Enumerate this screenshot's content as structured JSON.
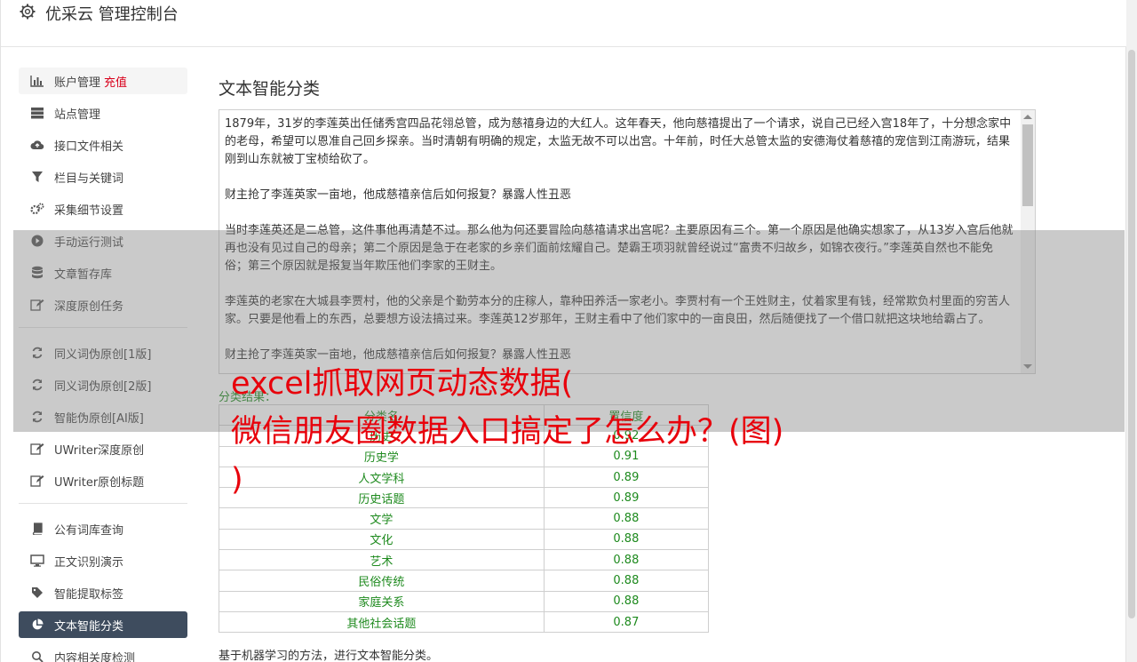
{
  "header": {
    "title": "优采云 管理控制台"
  },
  "sidebar": {
    "group1": [
      {
        "label": "账户管理",
        "extra": "充值",
        "icon": "bar-chart-icon"
      },
      {
        "label": "站点管理",
        "icon": "server-icon"
      },
      {
        "label": "接口文件相关",
        "icon": "cloud-upload-icon"
      },
      {
        "label": "栏目与关键词",
        "icon": "filter-icon"
      },
      {
        "label": "采集细节设置",
        "icon": "gears-icon"
      },
      {
        "label": "手动运行测试",
        "icon": "play-circle-icon"
      },
      {
        "label": "文章暂存库",
        "icon": "database-icon"
      },
      {
        "label": "深度原创任务",
        "icon": "edit-icon"
      }
    ],
    "group2": [
      {
        "label": "同义词伪原创[1版]",
        "icon": "refresh-icon"
      },
      {
        "label": "同义词伪原创[2版]",
        "icon": "refresh-icon"
      },
      {
        "label": "智能伪原创[AI版]",
        "icon": "refresh-icon"
      },
      {
        "label": "UWriter深度原创",
        "icon": "edit-icon"
      },
      {
        "label": "UWriter原创标题",
        "icon": "edit-icon"
      }
    ],
    "group3": [
      {
        "label": "公有词库查询",
        "icon": "book-icon"
      },
      {
        "label": "正文识别演示",
        "icon": "monitor-icon"
      },
      {
        "label": "智能提取标签",
        "icon": "tag-icon"
      },
      {
        "label": "文本智能分类",
        "icon": "pie-chart-icon",
        "active": true
      },
      {
        "label": "内容相关度检测",
        "icon": "search-icon"
      }
    ]
  },
  "main": {
    "title": "文本智能分类",
    "text_paragraphs": [
      "1879年，31岁的李莲英出任储秀宫四品花翎总管，成为慈禧身边的大红人。这年春天，他向慈禧提出了一个请求，说自己已经入宫18年了，十分想念家中的老母，希望可以恩准自己回乡探亲。当时清朝有明确的规定，太监无故不可以出宫。十年前，时任大总管太监的安德海仗着慈禧的宠信到江南游玩，结果刚到山东就被丁宝桢给砍了。",
      "财主抢了李莲英家一亩地，他成慈禧亲信后如何报复？暴露人性丑恶",
      "当时李莲英还是二总管，这件事他再清楚不过。那么他为何还要冒险向慈禧请求出宫呢？主要原因有三个。第一个原因是他确实想家了，从13岁入宫后他就再也没有见过自己的母亲；第二个原因是急于在老家的乡亲们面前炫耀自己。楚霸王项羽就曾经说过“富贵不归故乡，如锦衣夜行。”李莲英自然也不能免俗；第三个原因就是报复当年欺压他们李家的王财主。",
      "李莲英的老家在大城县李贾村，他的父亲是个勤劳本分的庄稼人，靠种田养活一家老小。李贾村有一个王姓财主，仗着家里有钱，经常欺负村里面的穷苦人家。只要是他看上的东西，总要想方设法搞过来。李莲英12岁那年，王财主看中了他们家中的一亩良田，然后随便找了一个借口就把这块地给霸占了。",
      "财主抢了李莲英家一亩地，他成慈禧亲信后如何报复？暴露人性丑恶"
    ],
    "result_label": "分类结果：",
    "table": {
      "headers": [
        "分类名",
        "置信度"
      ],
      "rows": [
        [
          "历史",
          "0.92"
        ],
        [
          "历史学",
          "0.91"
        ],
        [
          "人文学科",
          "0.89"
        ],
        [
          "历史话题",
          "0.89"
        ],
        [
          "文学",
          "0.88"
        ],
        [
          "文化",
          "0.88"
        ],
        [
          "艺术",
          "0.88"
        ],
        [
          "民俗传统",
          "0.88"
        ],
        [
          "家庭关系",
          "0.88"
        ],
        [
          "其他社会话题",
          "0.87"
        ]
      ]
    },
    "footnote": "基于机器学习的方法，进行文本智能分类。"
  },
  "ad_overlay": {
    "lines": [
      "excel抓取网页动态数据(",
      "微信朋友圈数据入口搞定了怎么办？(图)",
      ")"
    ]
  },
  "colors": {
    "active_nav": "#3e4c5e",
    "accent_red": "#d9001b",
    "result_green": "#1e8a1e",
    "ad_red": "#e8000b"
  }
}
